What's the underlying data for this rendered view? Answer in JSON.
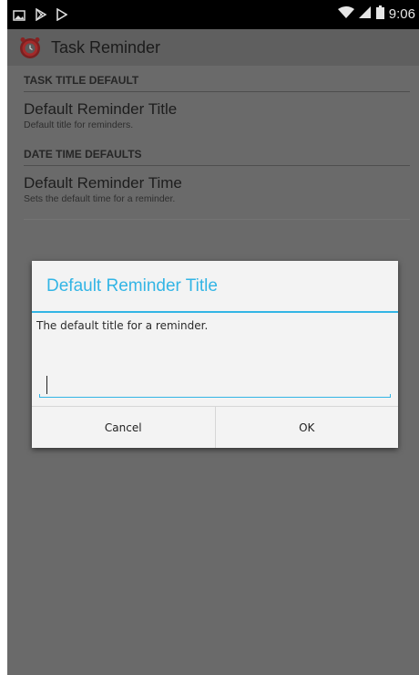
{
  "status_bar": {
    "icons_left": [
      "gallery-icon",
      "playstore-icon",
      "play-icon"
    ],
    "icons_right": [
      "wifi-icon",
      "signal-icon",
      "battery-icon"
    ],
    "time": "9:06"
  },
  "action_bar": {
    "app_icon": "alarm-clock-icon",
    "title": "Task Reminder"
  },
  "settings": {
    "section1": "TASK TITLE DEFAULT",
    "pref1_title": "Default Reminder Title",
    "pref1_summary": "Default title for reminders.",
    "section2": "DATE TIME DEFAULTS",
    "pref2_title": "Default Reminder Time",
    "pref2_summary": "Sets the default time for a reminder."
  },
  "dialog": {
    "title": "Default Reminder Title",
    "message": "The default title for a reminder.",
    "input_value": "",
    "cancel_label": "Cancel",
    "ok_label": "OK"
  },
  "colors": {
    "accent": "#33b5e5",
    "status_bar": "#000000",
    "scrim": "#6a6a6a",
    "dialog_bg": "#f3f3f3"
  }
}
